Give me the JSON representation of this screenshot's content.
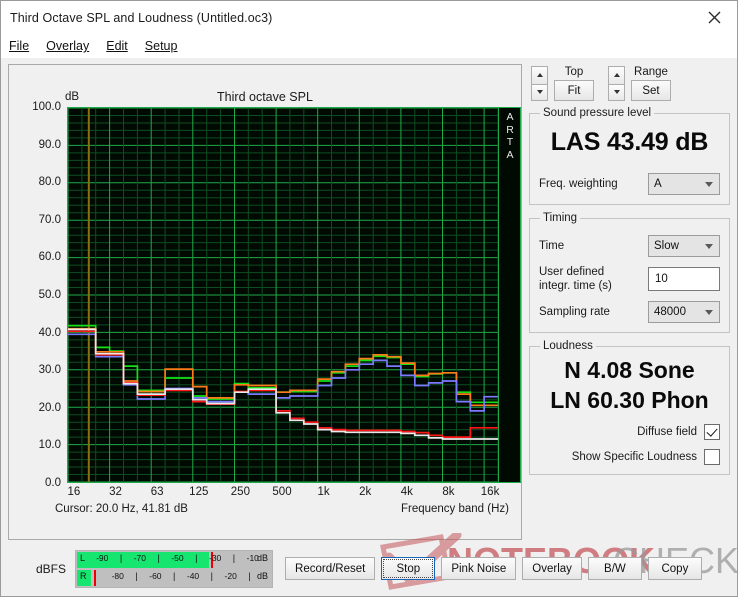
{
  "window": {
    "title": "Third Octave SPL and Loudness (Untitled.oc3)",
    "close_icon": "close-icon"
  },
  "menu": [
    {
      "label": "File",
      "mnemonic": "F"
    },
    {
      "label": "Overlay",
      "mnemonic": "O"
    },
    {
      "label": "Edit",
      "mnemonic": "E"
    },
    {
      "label": "Setup",
      "mnemonic": "S"
    }
  ],
  "graph": {
    "title": "Third octave SPL",
    "y_unit": "dB",
    "watermark_text": "ARTA",
    "cursor_text": "Cursor:   20.0 Hz, 41.81 dB",
    "x_axis_title": "Frequency band (Hz)"
  },
  "controls": {
    "top": {
      "label": "Top",
      "button": "Fit",
      "up_icon": "triangle-up-icon",
      "down_icon": "triangle-down-icon"
    },
    "range": {
      "label": "Range",
      "button": "Set",
      "up_icon": "triangle-up-icon",
      "down_icon": "triangle-down-icon"
    }
  },
  "spl": {
    "group_label": "Sound pressure level",
    "value": "LAS 43.49 dB",
    "weighting_label": "Freq. weighting",
    "weighting_value": "A"
  },
  "timing": {
    "group_label": "Timing",
    "time_label": "Time",
    "time_value": "Slow",
    "integr_label": "User defined\nintegr. time (s)",
    "integr_label_line1": "User defined",
    "integr_label_line2": "integr. time (s)",
    "integr_value": "10",
    "sampling_label": "Sampling rate",
    "sampling_value": "48000"
  },
  "loudness": {
    "group_label": "Loudness",
    "sone": "N 4.08 Sone",
    "phon": "LN 60.30 Phon",
    "diffuse_label": "Diffuse field",
    "diffuse_checked": true,
    "specific_label": "Show Specific Loudness",
    "specific_checked": false
  },
  "meter": {
    "label": "dBFS",
    "unit": "dB",
    "left": {
      "channel": "L",
      "ticks": [
        "-90",
        "-70",
        "-50",
        "-30",
        "-10"
      ],
      "fill_pct": 68,
      "peak_pct": 69
    },
    "right": {
      "channel": "R",
      "ticks": [
        "-80",
        "-60",
        "-40",
        "-20"
      ],
      "fill_pct": 7,
      "peak_pct": 9
    }
  },
  "buttons": [
    {
      "label": "Record/Reset",
      "focused": false
    },
    {
      "label": "Stop",
      "focused": true
    },
    {
      "label": "Pink Noise",
      "focused": false
    },
    {
      "label": "Overlay",
      "focused": false
    },
    {
      "label": "B/W",
      "focused": false
    },
    {
      "label": "Copy",
      "focused": false
    }
  ],
  "watermark": {
    "text1": "NOTEBOOK",
    "text2": "CHECK"
  },
  "chart_data": {
    "type": "line",
    "title": "Third octave SPL",
    "xlabel": "Frequency band (Hz)",
    "ylabel": "dB",
    "ylim": [
      0.0,
      100.0
    ],
    "ytick_step": 10.0,
    "yticks": [
      "100.0",
      "90.0",
      "80.0",
      "70.0",
      "60.0",
      "50.0",
      "40.0",
      "30.0",
      "20.0",
      "10.0",
      "0.0"
    ],
    "xticks": [
      "16",
      "32",
      "63",
      "125",
      "250",
      "500",
      "1k",
      "2k",
      "4k",
      "8k",
      "16k"
    ],
    "x_log": true,
    "grid": true,
    "plot_bg": "#010a02",
    "grid_color": "#1faa4a",
    "cursor": {
      "freq_hz": 20.0,
      "level_db": 41.81,
      "color": "#8a7010"
    },
    "categories": [
      16,
      20,
      25,
      31.5,
      40,
      50,
      63,
      80,
      100,
      125,
      160,
      200,
      250,
      315,
      400,
      500,
      630,
      800,
      1000,
      1250,
      1600,
      2000,
      2500,
      3150,
      4000,
      5000,
      6300,
      8000,
      10000,
      12500,
      16000
    ],
    "series": [
      {
        "name": "trace-green",
        "color": "#14e014",
        "values": [
          41.8,
          41.8,
          36.0,
          35.0,
          31.0,
          24.5,
          24.5,
          27.8,
          27.8,
          23.0,
          22.2,
          22.2,
          26.3,
          25.2,
          25.2,
          24.0,
          24.2,
          24.2,
          27.0,
          29.2,
          31.0,
          32.5,
          33.6,
          33.3,
          31.5,
          28.2,
          28.9,
          29.2,
          24.0,
          21.3,
          21.3
        ]
      },
      {
        "name": "trace-orange",
        "color": "#ff7a18",
        "values": [
          41.0,
          41.0,
          34.8,
          34.8,
          27.0,
          24.2,
          24.2,
          30.2,
          30.2,
          25.5,
          22.5,
          22.5,
          26.0,
          25.8,
          25.8,
          24.0,
          24.5,
          24.5,
          27.5,
          29.5,
          31.5,
          33.0,
          34.0,
          33.5,
          31.8,
          28.5,
          29.0,
          29.2,
          23.5,
          20.5,
          20.5
        ]
      },
      {
        "name": "trace-blue",
        "color": "#7b7bff",
        "values": [
          39.5,
          39.5,
          33.5,
          33.5,
          26.0,
          22.2,
          22.2,
          25.0,
          25.0,
          22.5,
          21.5,
          21.5,
          24.0,
          23.5,
          23.5,
          22.5,
          23.0,
          23.0,
          25.8,
          27.8,
          30.0,
          31.5,
          32.5,
          31.0,
          28.5,
          25.8,
          26.5,
          27.0,
          21.5,
          19.0,
          22.8
        ]
      },
      {
        "name": "trace-red",
        "color": "#ff1515",
        "values": [
          40.3,
          40.3,
          34.0,
          34.0,
          26.5,
          23.2,
          23.2,
          24.5,
          24.5,
          21.5,
          20.8,
          20.8,
          24.2,
          24.5,
          24.5,
          19.0,
          17.0,
          16.0,
          14.5,
          14.0,
          13.8,
          13.8,
          13.8,
          13.8,
          13.5,
          13.2,
          12.5,
          12.0,
          12.0,
          14.5,
          14.5
        ]
      },
      {
        "name": "trace-white",
        "color": "#e9e9e9",
        "values": [
          40.8,
          40.8,
          34.3,
          34.3,
          26.3,
          23.5,
          23.5,
          24.8,
          24.8,
          22.0,
          21.0,
          21.0,
          24.0,
          24.8,
          24.8,
          18.5,
          16.5,
          15.5,
          14.0,
          13.5,
          13.3,
          13.3,
          13.3,
          13.3,
          13.0,
          12.5,
          11.8,
          11.5,
          11.5,
          11.5,
          11.5
        ]
      }
    ]
  }
}
